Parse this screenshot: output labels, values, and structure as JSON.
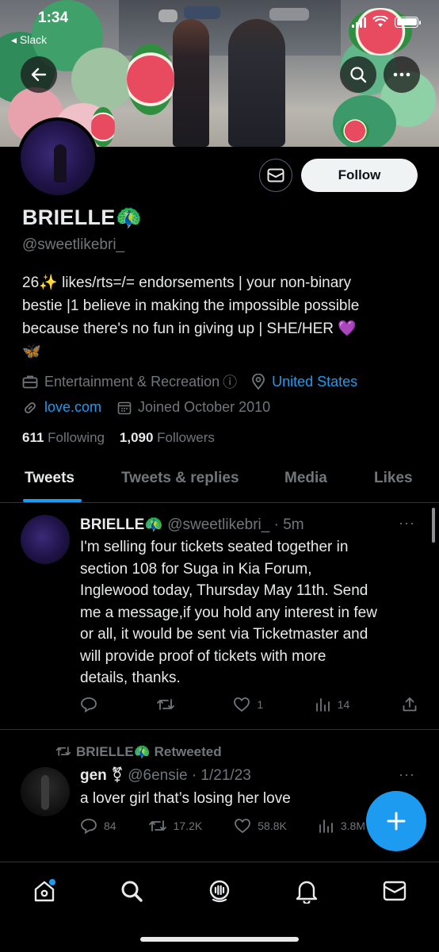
{
  "status_bar": {
    "time": "1:34",
    "back_app": "◂ Slack"
  },
  "profile": {
    "name": "BRIELLE🦚",
    "handle": "@sweetlikebri_",
    "follow_label": "Follow",
    "bio_lines": [
      "26✨ likes/rts=/= endorsements | your non-binary",
      "bestie |1 believe in making the impossible possible",
      "because there's no fun in giving up | SHE/HER 💜",
      "🦋"
    ],
    "category": "Entertainment & Recreation",
    "info_glyph": "ⓘ",
    "location": "United States",
    "website": "love.com",
    "joined": "Joined October 2010",
    "following_count": "611",
    "following_label": "Following",
    "followers_count": "1,090",
    "followers_label": "Followers"
  },
  "tabs": [
    {
      "label": "Tweets",
      "active": true
    },
    {
      "label": "Tweets & replies",
      "active": false
    },
    {
      "label": "Media",
      "active": false
    },
    {
      "label": "Likes",
      "active": false
    }
  ],
  "tweets": [
    {
      "author": "BRIELLE🦚",
      "handle": "@sweetlikebri_",
      "time": "· 5m",
      "text_lines": [
        "I'm selling four tickets seated together in",
        "section 108 for Suga in Kia Forum,",
        "Inglewood today, Thursday May 11th. Send",
        "me a message,if you hold any interest in few",
        "or all, it would be sent via Ticketmaster and",
        "will provide proof of tickets with more",
        "details, thanks."
      ],
      "replies": "",
      "retweets": "",
      "likes": "1",
      "views": "14",
      "more": "···"
    },
    {
      "retweeted_by": "BRIELLE🦚 Retweeted",
      "author": "gen ⚧",
      "handle": "@6ensie",
      "time": "· 1/21/23",
      "text": "a lover girl that’s losing her love",
      "replies": "84",
      "retweets": "17.2K",
      "likes": "58.8K",
      "views": "3.8M",
      "more": "···"
    }
  ],
  "colors": {
    "accent": "#1d9bf0",
    "text": "#e7e9ea",
    "muted": "#71767b",
    "border": "#2f3336"
  }
}
